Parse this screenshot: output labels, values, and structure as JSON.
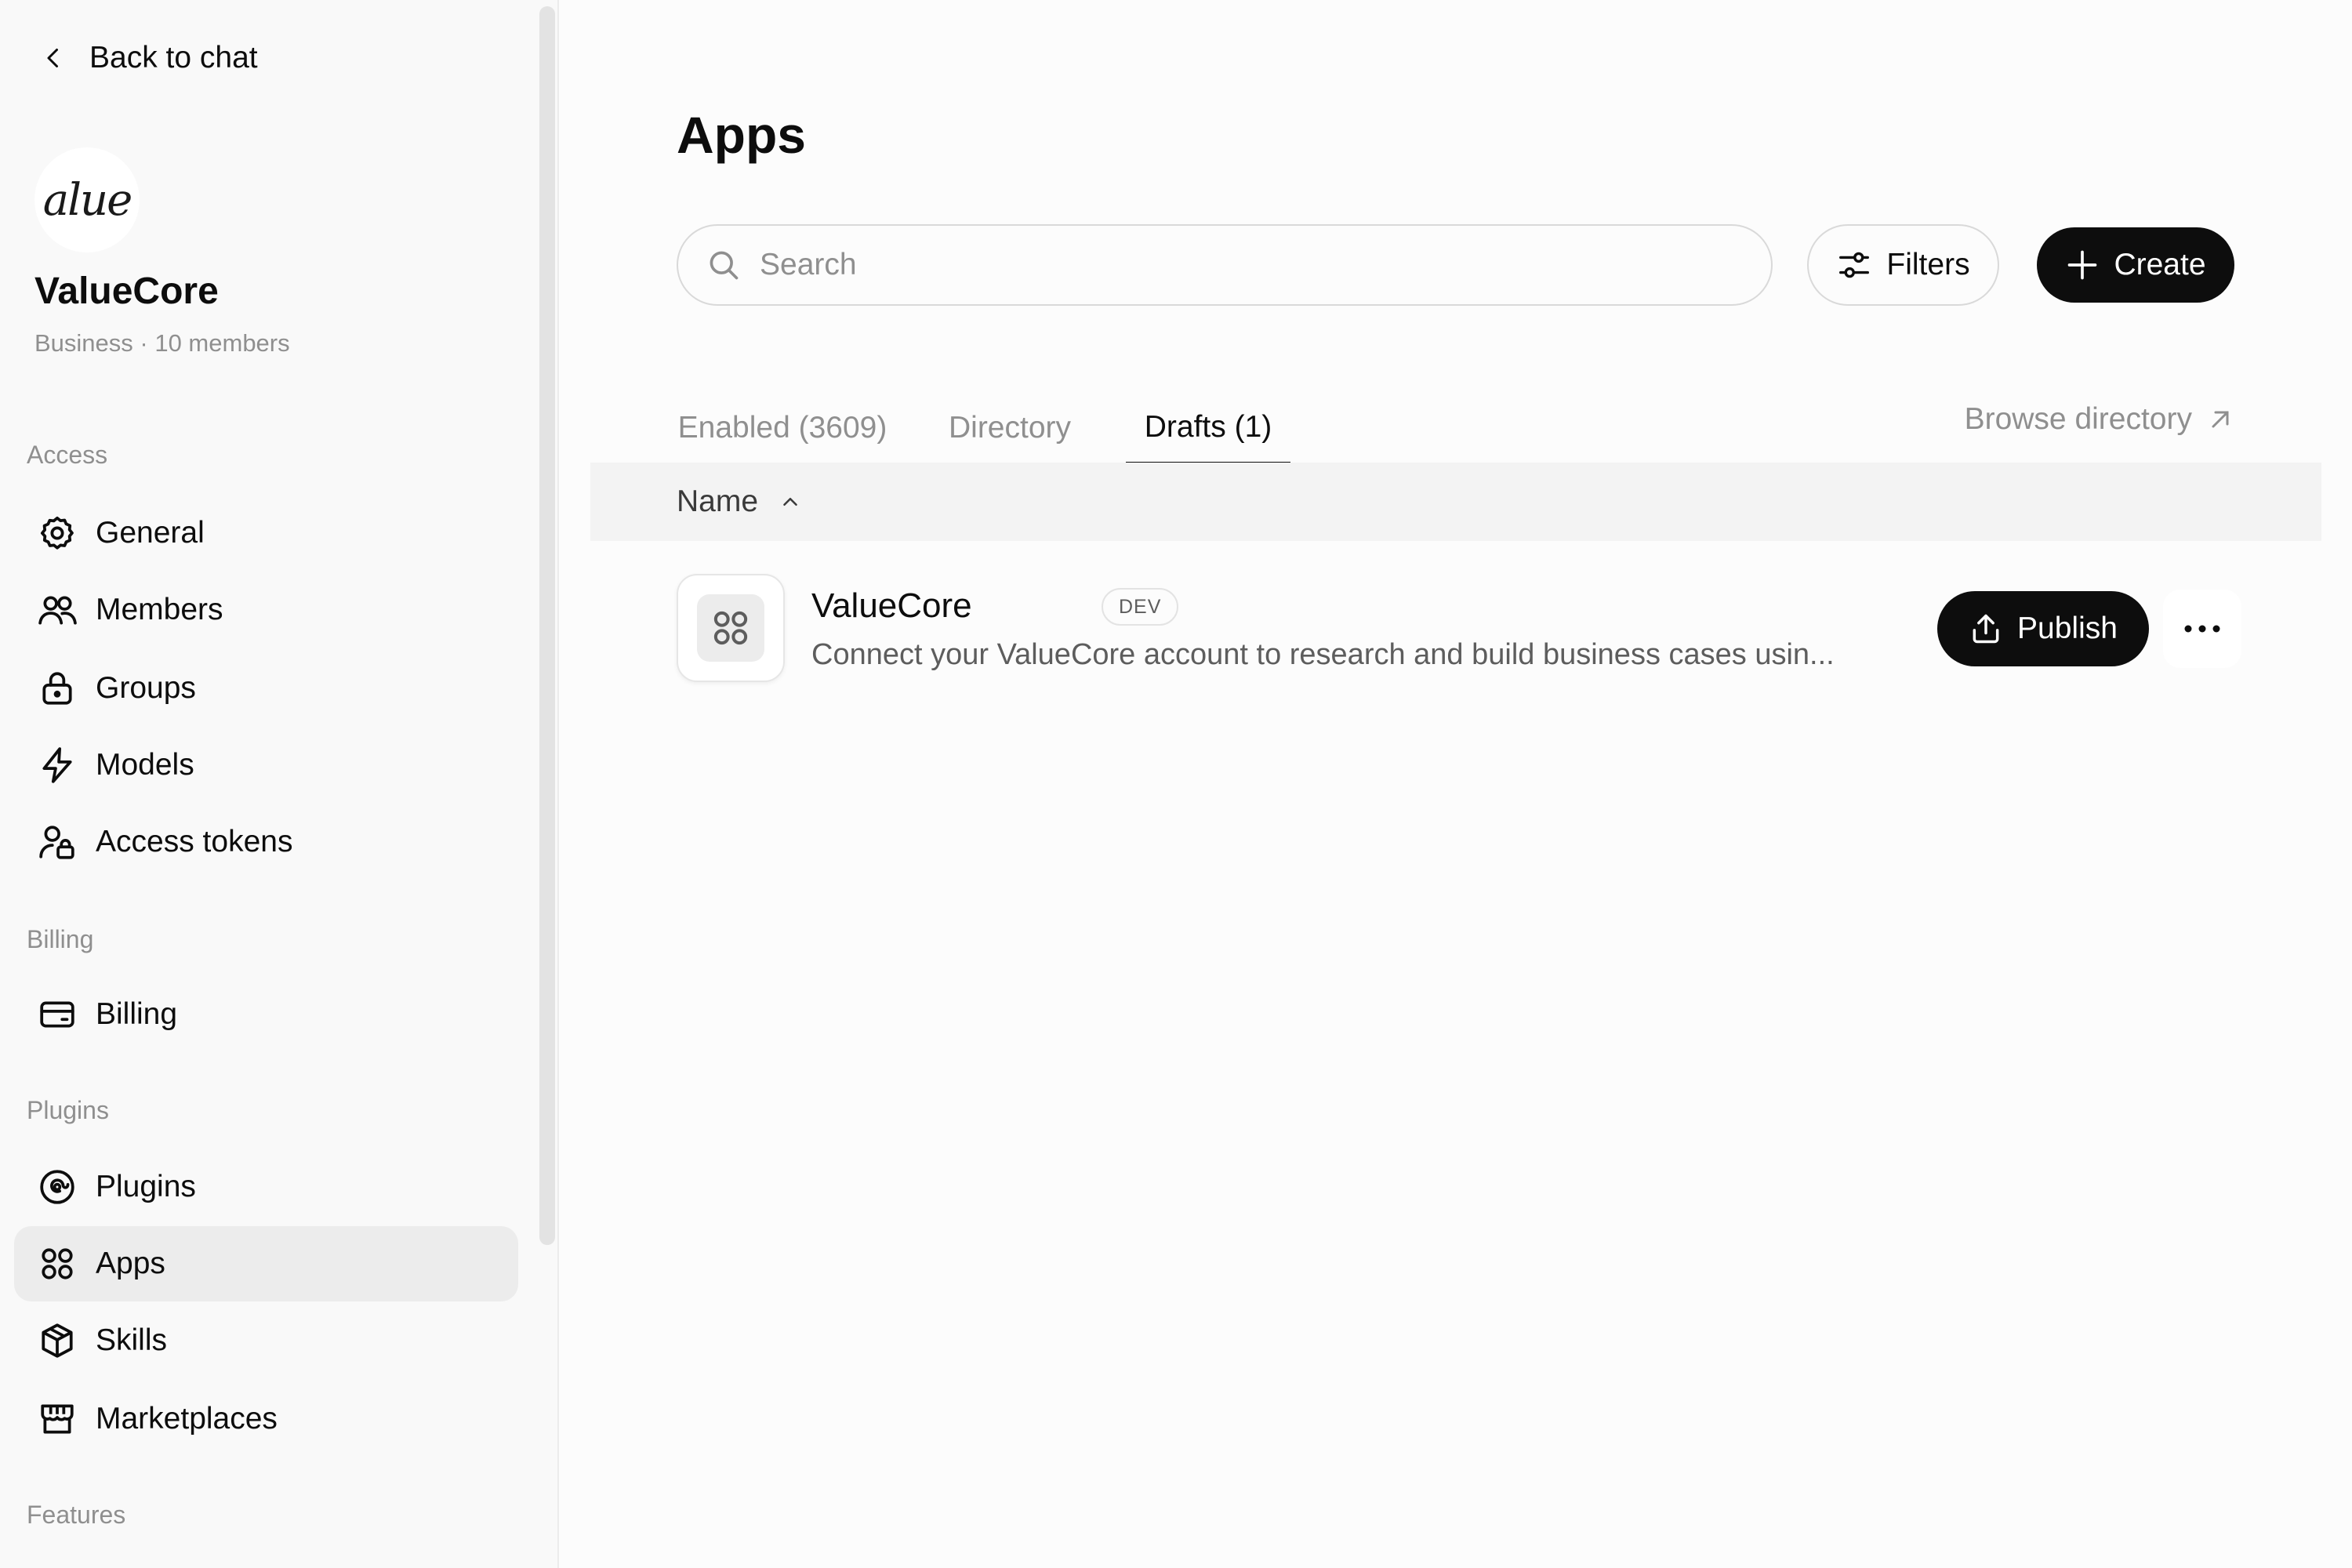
{
  "sidebar": {
    "back_label": "Back to chat",
    "logo_text": "alue",
    "org_name": "ValueCore",
    "org_meta": "Business · 10 members",
    "sections": {
      "access": "Access",
      "billing": "Billing",
      "plugins": "Plugins",
      "features": "Features"
    },
    "items": {
      "general": "General",
      "members": "Members",
      "groups": "Groups",
      "models": "Models",
      "access_tokens": "Access tokens",
      "billing": "Billing",
      "plugins": "Plugins",
      "apps": "Apps",
      "skills": "Skills",
      "marketplaces": "Marketplaces"
    },
    "active_item": "apps"
  },
  "main": {
    "title": "Apps",
    "search_placeholder": "Search",
    "filters_label": "Filters",
    "create_label": "Create",
    "tabs": {
      "enabled": "Enabled (3609)",
      "directory": "Directory",
      "drafts": "Drafts (1)"
    },
    "active_tab": "drafts",
    "browse_label": "Browse directory",
    "column_name": "Name",
    "rows": [
      {
        "name": "ValueCore",
        "badge": "DEV",
        "description": "Connect your ValueCore account to research and build business cases usin...",
        "publish_label": "Publish"
      }
    ]
  },
  "colors": {
    "primary_button": "#0d0d0d",
    "active_nav": "#ececec",
    "muted_text": "#8f8f8f"
  }
}
